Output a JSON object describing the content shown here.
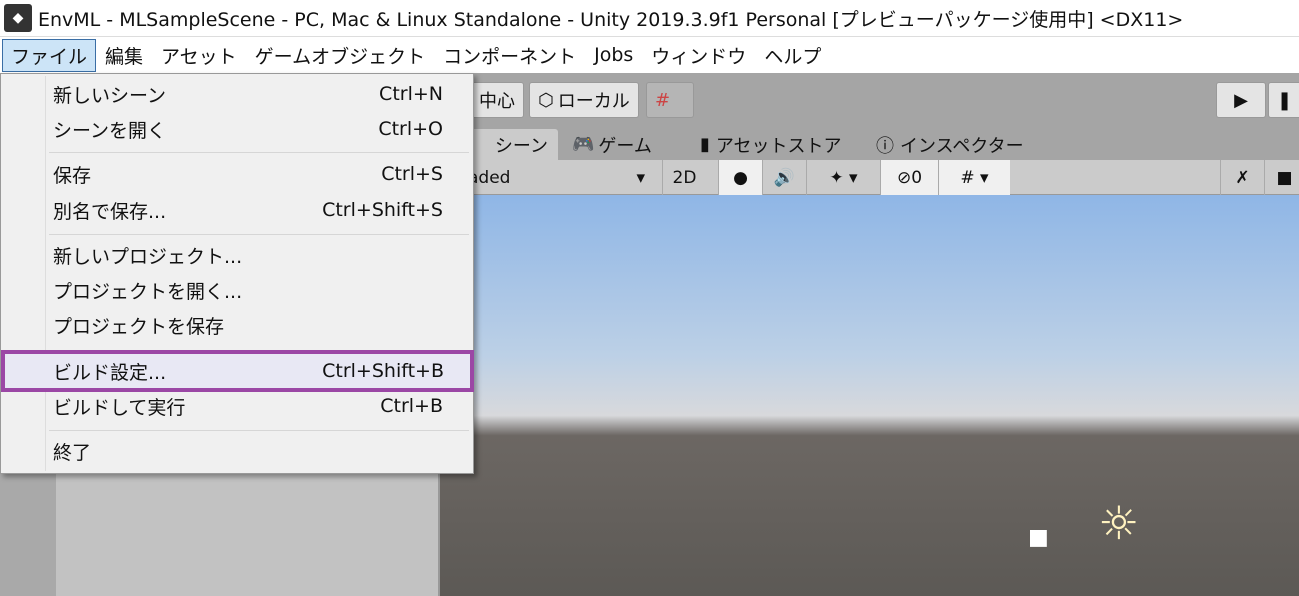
{
  "window": {
    "title": "EnvML - MLSampleScene - PC, Mac & Linux Standalone - Unity 2019.3.9f1 Personal [プレビューパッケージ使用中] <DX11>"
  },
  "menubar": [
    "ファイル",
    "編集",
    "アセット",
    "ゲームオブジェクト",
    "コンポーネント",
    "Jobs",
    "ウィンドウ",
    "ヘルプ"
  ],
  "file_menu": [
    {
      "label": "新しいシーン",
      "shortcut": "Ctrl+N"
    },
    {
      "label": "シーンを開く",
      "shortcut": "Ctrl+O"
    },
    {
      "label": "保存",
      "shortcut": "Ctrl+S"
    },
    {
      "label": "別名で保存...",
      "shortcut": "Ctrl+Shift+S"
    },
    {
      "label": "新しいプロジェクト...",
      "shortcut": ""
    },
    {
      "label": "プロジェクトを開く...",
      "shortcut": ""
    },
    {
      "label": "プロジェクトを保存",
      "shortcut": ""
    },
    {
      "label": "ビルド設定...",
      "shortcut": "Ctrl+Shift+B"
    },
    {
      "label": "ビルドして実行",
      "shortcut": "Ctrl+B"
    },
    {
      "label": "終了",
      "shortcut": ""
    }
  ],
  "toolbar": {
    "pivot": "中心",
    "space": "ローカル"
  },
  "tabs": [
    "シーン",
    "ゲーム",
    "アセットストア",
    "インスペクター"
  ],
  "scenebar": {
    "draw_mode": "aded",
    "mode_2d": "2D",
    "hidden_count": "0"
  },
  "colors": {
    "highlight": "#9b47a5"
  }
}
